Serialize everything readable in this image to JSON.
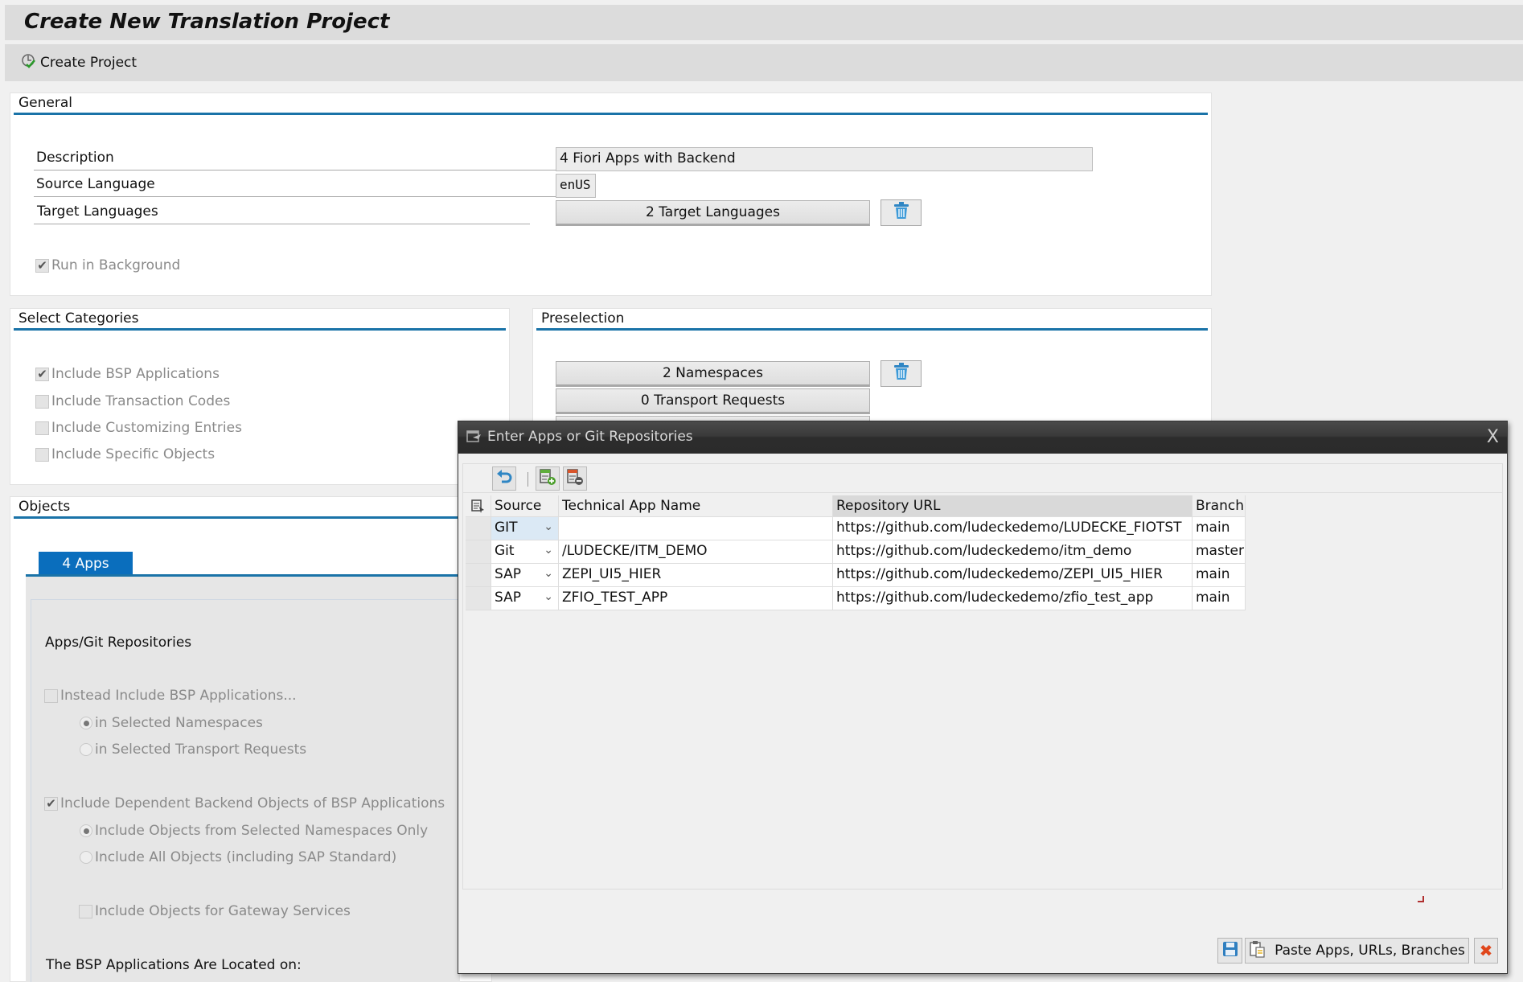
{
  "window": {
    "title": "Create New Translation Project"
  },
  "toolbar": {
    "create_project_label": "Create Project",
    "create_project_icon": "execute-check-icon"
  },
  "general": {
    "title": "General",
    "description_label": "Description",
    "description_value": "4 Fiori Apps with Backend",
    "source_language_label": "Source Language",
    "source_language_value": "enUS",
    "target_languages_label": "Target Languages",
    "target_languages_button": "2  Target Languages",
    "run_in_background_label": "Run in Background",
    "run_in_background_checked": true
  },
  "categories": {
    "title": "Select Categories",
    "items": [
      {
        "label": "Include BSP Applications",
        "checked": true
      },
      {
        "label": "Include Transaction Codes",
        "checked": false
      },
      {
        "label": "Include Customizing Entries",
        "checked": false
      },
      {
        "label": "Include Specific Objects",
        "checked": false
      }
    ]
  },
  "preselection": {
    "title": "Preselection",
    "namespaces_button": "2  Namespaces",
    "transport_requests_button": "0  Transport Requests"
  },
  "objects": {
    "title": "Objects",
    "tab_label": "4  Apps",
    "section_title": "Apps/Git Repositories",
    "instead_include_label": "Instead Include BSP Applications...",
    "instead_radio_1": "in Selected Namespaces",
    "instead_radio_2": "in Selected Transport Requests",
    "dependent_label": "Include Dependent Backend Objects of BSP Applications",
    "dependent_radio_1": "Include Objects from Selected Namespaces Only",
    "dependent_radio_2": "Include All Objects (including SAP Standard)",
    "gateway_label": "Include Objects for Gateway Services",
    "located_on_label": "The BSP Applications Are Located on:"
  },
  "dialog": {
    "title": "Enter Apps or Git Repositories",
    "close_label": "X",
    "columns": [
      "Source",
      "Technical App Name",
      "Repository URL",
      "Branch"
    ],
    "rows": [
      {
        "source": "GIT",
        "app": "",
        "url": "https://github.com/ludeckedemo/LUDECKE_FIOTST",
        "branch": "main"
      },
      {
        "source": "Git",
        "app": "/LUDECKE/ITM_DEMO",
        "url": "https://github.com/ludeckedemo/itm_demo",
        "branch": "master"
      },
      {
        "source": "SAP",
        "app": "ZEPI_UI5_HIER",
        "url": "https://github.com/ludeckedemo/ZEPI_UI5_HIER",
        "branch": "main"
      },
      {
        "source": "SAP",
        "app": "ZFIO_TEST_APP",
        "url": "https://github.com/ludeckedemo/zfio_test_app",
        "branch": "main"
      }
    ],
    "paste_button": "Paste Apps, URLs, Branches"
  },
  "colors": {
    "accent": "#1a73a8",
    "tab": "#0a6ebd",
    "dialog_title": "#2b2b2b",
    "cancel": "#e0461b"
  }
}
